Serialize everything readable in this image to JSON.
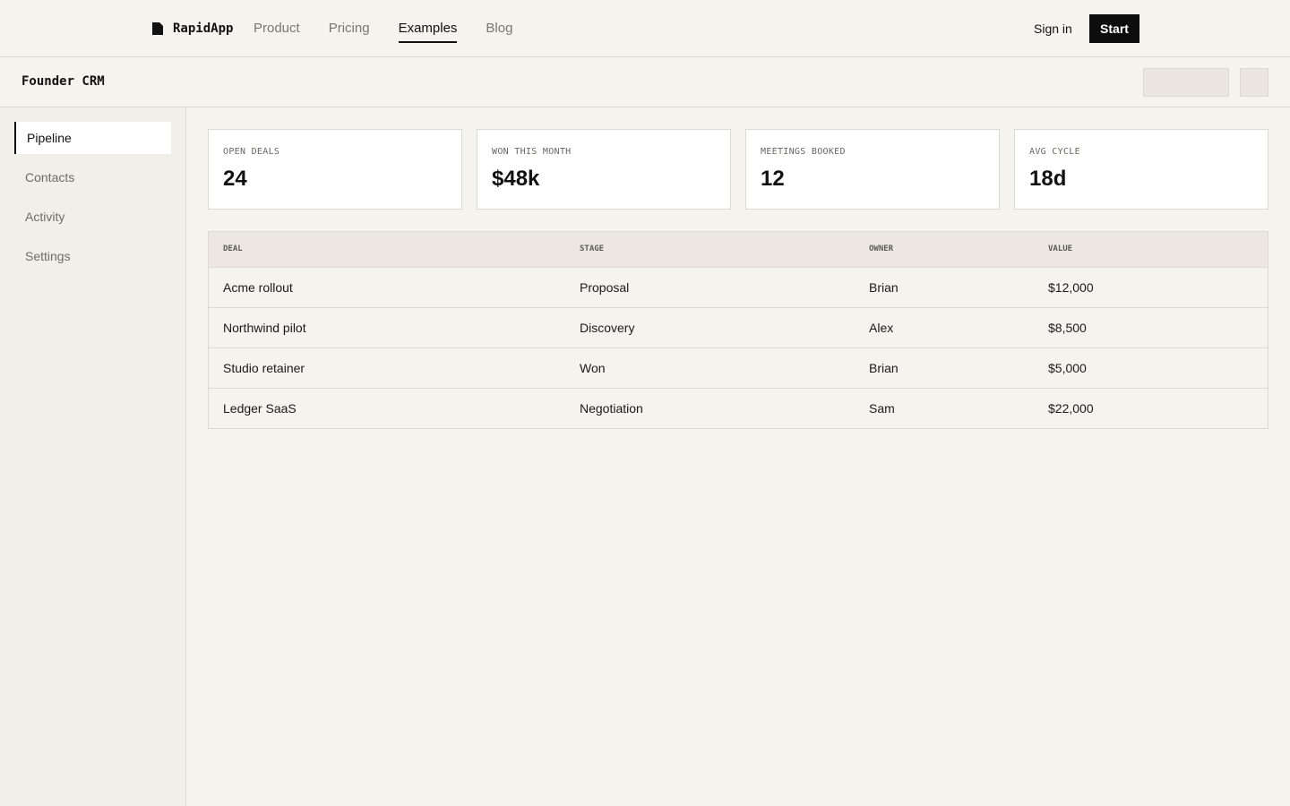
{
  "nav": {
    "brand": "RapidApp",
    "brand_icon": "page-icon",
    "links": [
      {
        "label": "Product",
        "active": false
      },
      {
        "label": "Pricing",
        "active": false
      },
      {
        "label": "Examples",
        "active": true
      },
      {
        "label": "Blog",
        "active": false
      }
    ],
    "signin": "Sign in",
    "start": "Start"
  },
  "app": {
    "title": "Founder CRM"
  },
  "sidebar": {
    "items": [
      {
        "label": "Pipeline",
        "active": true
      },
      {
        "label": "Contacts",
        "active": false
      },
      {
        "label": "Activity",
        "active": false
      },
      {
        "label": "Settings",
        "active": false
      }
    ]
  },
  "kpis": [
    {
      "label": "OPEN DEALS",
      "value": "24"
    },
    {
      "label": "WON THIS MONTH",
      "value": "$48k"
    },
    {
      "label": "MEETINGS BOOKED",
      "value": "12"
    },
    {
      "label": "AVG CYCLE",
      "value": "18d"
    }
  ],
  "table": {
    "headers": [
      "DEAL",
      "STAGE",
      "OWNER",
      "VALUE"
    ],
    "rows": [
      [
        "Acme rollout",
        "Proposal",
        "Brian",
        "$12,000"
      ],
      [
        "Northwind pilot",
        "Discovery",
        "Alex",
        "$8,500"
      ],
      [
        "Studio retainer",
        "Won",
        "Brian",
        "$5,000"
      ],
      [
        "Ledger SaaS",
        "Negotiation",
        "Sam",
        "$22,000"
      ]
    ]
  },
  "colors": {
    "accent": "#0d0d0d",
    "background": "#f5f3ee",
    "card": "#ffffff",
    "border": "#dedad2"
  }
}
